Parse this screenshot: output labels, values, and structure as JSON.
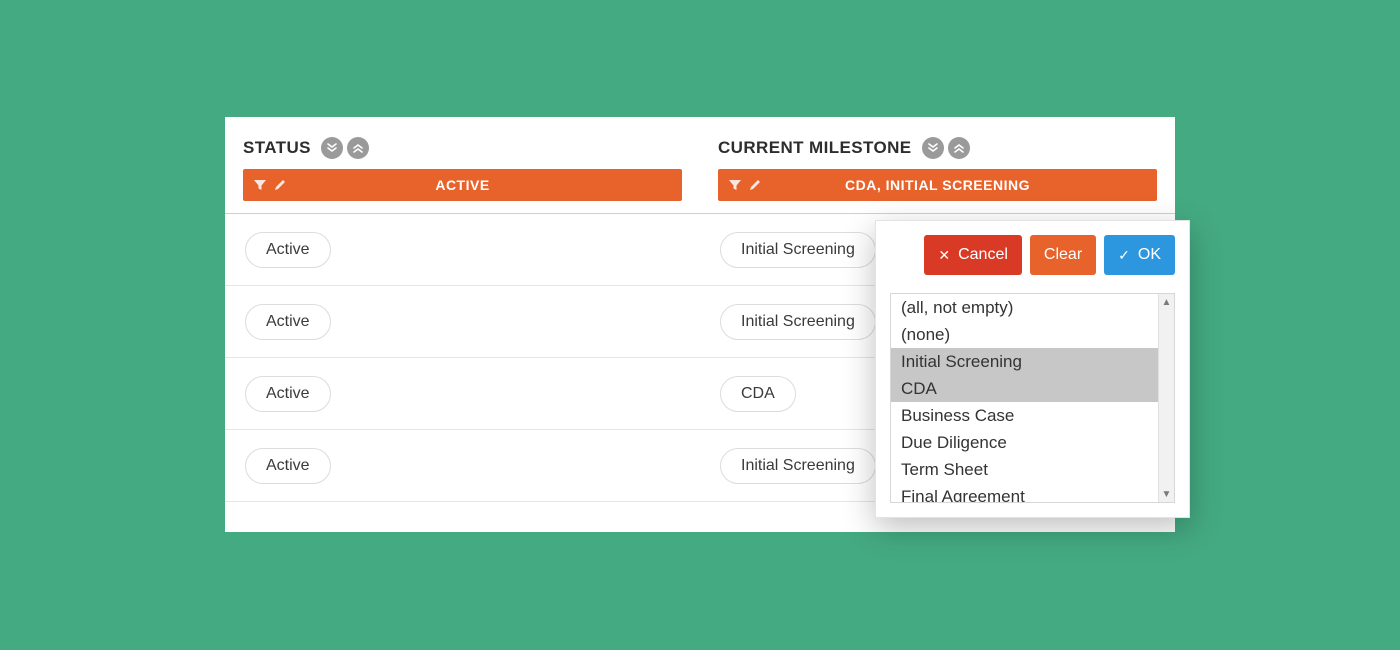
{
  "columns": {
    "status": {
      "title": "STATUS",
      "filter_label": "ACTIVE",
      "rows": [
        "Active",
        "Active",
        "Active",
        "Active"
      ]
    },
    "milestone": {
      "title": "CURRENT MILESTONE",
      "filter_label": "CDA, INITIAL SCREENING",
      "rows": [
        "Initial Screening",
        "Initial Screening",
        "CDA",
        "Initial Screening"
      ]
    }
  },
  "popup": {
    "cancel_label": "Cancel",
    "clear_label": "Clear",
    "ok_label": "OK",
    "options": [
      {
        "label": "(all, not empty)",
        "selected": false
      },
      {
        "label": "(none)",
        "selected": false
      },
      {
        "label": "Initial Screening",
        "selected": true
      },
      {
        "label": "CDA",
        "selected": true
      },
      {
        "label": "Business Case",
        "selected": false
      },
      {
        "label": "Due Diligence",
        "selected": false
      },
      {
        "label": "Term Sheet",
        "selected": false
      },
      {
        "label": "Final Agreement",
        "selected": false
      }
    ]
  },
  "colors": {
    "page_bg": "#44aa82",
    "accent_orange": "#e8622b",
    "danger_red": "#d83a26",
    "primary_blue": "#2c97de",
    "sort_gray": "#9a9a9a"
  }
}
